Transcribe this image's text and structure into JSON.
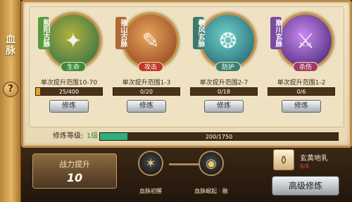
{
  "side": {
    "title": "血脉",
    "help_glyph": "?"
  },
  "cards": [
    {
      "name": "殷阳古脉",
      "tag": "生命",
      "range": "单次提升范围10-70",
      "progress": "25/400",
      "fill": 0.0625,
      "button": "修炼",
      "colors": {
        "banner": "#5a9a3a",
        "tag": "#3d8b3a",
        "orb_a": "#1e6b4a",
        "orb_b": "#b5b03c"
      }
    },
    {
      "name": "摧山古脉",
      "tag": "攻击",
      "range": "单次提升范围1-3",
      "progress": "0/20",
      "fill": 0,
      "button": "修炼",
      "colors": {
        "banner": "#b06a3a",
        "tag": "#c0392b",
        "orb_a": "#8a3b1a",
        "orb_b": "#e8a45a"
      }
    },
    {
      "name": "羲风玄脉",
      "tag": "防护",
      "range": "单次提升范围2-7",
      "progress": "0/18",
      "fill": 0,
      "button": "修炼",
      "colors": {
        "banner": "#3f7a6a",
        "tag": "#3a7f6f",
        "orb_a": "#1a5a6a",
        "orb_b": "#6fd0c8"
      }
    },
    {
      "name": "崩川玄脉",
      "tag": "杀伤",
      "range": "单次提升范围1-2",
      "progress": "0/6",
      "fill": 0,
      "button": "修炼",
      "colors": {
        "banner": "#7a4aa0",
        "tag": "#a03a6a",
        "orb_a": "#3a1a6a",
        "orb_b": "#c98af0"
      }
    }
  ],
  "level": {
    "label": "修炼等级:",
    "value": "1级",
    "progress": "200/1750",
    "fill": 0.114
  },
  "power": {
    "label": "战力提升",
    "value": "10"
  },
  "skills": [
    {
      "name": "血脉初醒",
      "icon": "awaken-icon"
    },
    {
      "name": "血脉崛起 · 融",
      "icon": "rise-icon"
    }
  ],
  "item": {
    "name": "玄黄地乳",
    "count": "0/8",
    "icon": "bottle-icon"
  },
  "advanced_button": "高级修炼",
  "colors": {
    "panel": "#efe2c3",
    "gold": "#c69345",
    "bar": "#e2a52c",
    "level_bar": "#2fae7f"
  }
}
